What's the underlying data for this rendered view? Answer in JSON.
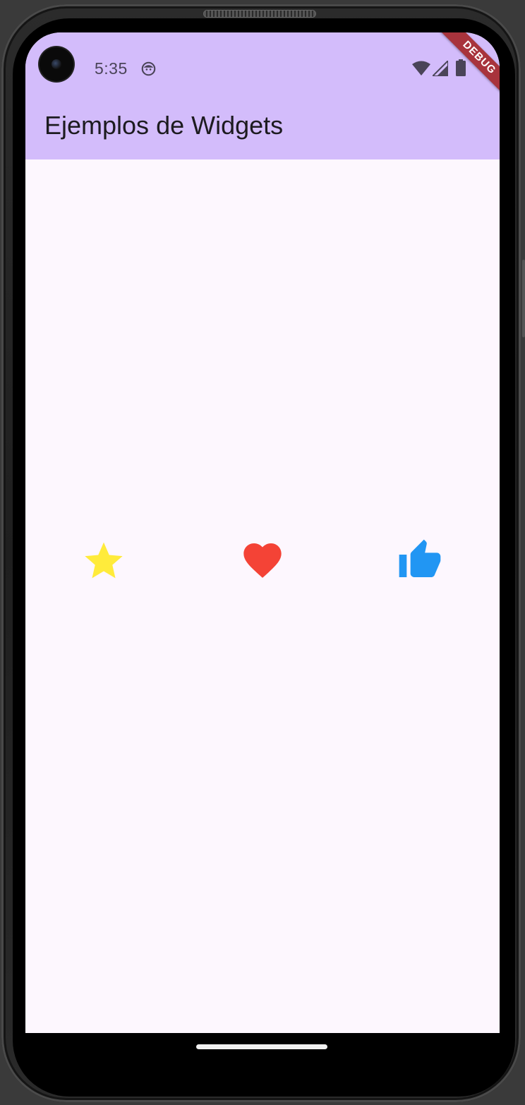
{
  "status_bar": {
    "time": "5:35",
    "notification_icon": "face-icon",
    "wifi_icon": "wifi-icon",
    "signal_icon": "signal-icon",
    "battery_icon": "battery-icon"
  },
  "debug_banner": {
    "label": "DEBUG",
    "color": "#a8333c"
  },
  "app_bar": {
    "title": "Ejemplos de Widgets",
    "background": "#d3bcfb"
  },
  "body": {
    "background": "#fdf7fe",
    "icons": [
      {
        "name": "star-icon",
        "color": "#ffeb3b"
      },
      {
        "name": "heart-icon",
        "color": "#f44336"
      },
      {
        "name": "thumb-up-icon",
        "color": "#2196f3"
      }
    ]
  }
}
